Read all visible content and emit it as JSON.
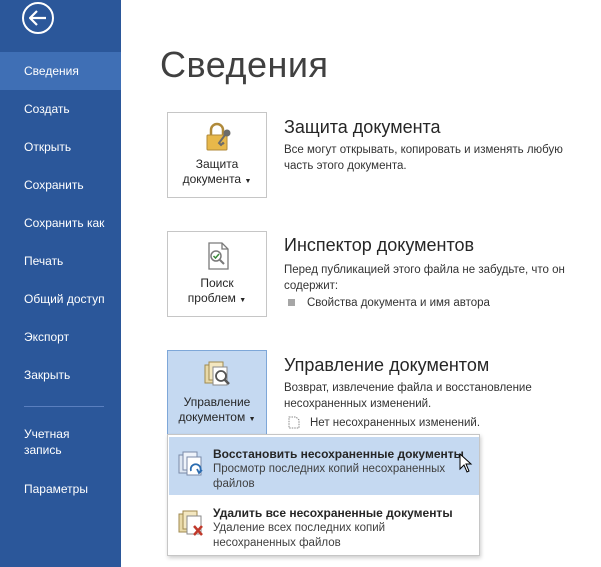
{
  "sidebar": {
    "items": [
      {
        "label": "Сведения"
      },
      {
        "label": "Создать"
      },
      {
        "label": "Открыть"
      },
      {
        "label": "Сохранить"
      },
      {
        "label": "Сохранить как"
      },
      {
        "label": "Печать"
      },
      {
        "label": "Общий доступ"
      },
      {
        "label": "Экспорт"
      },
      {
        "label": "Закрыть"
      },
      {
        "label": "Учетная запись"
      },
      {
        "label": "Параметры"
      }
    ]
  },
  "page": {
    "title": "Сведения"
  },
  "protect": {
    "tile_line1": "Защита",
    "tile_line2": "документа",
    "title": "Защита документа",
    "desc": "Все могут открывать, копировать и изменять любую часть этого документа."
  },
  "inspect": {
    "tile_line1": "Поиск",
    "tile_line2": "проблем",
    "title": "Инспектор документов",
    "desc": "Перед публикацией этого файла не забудьте, что он содержит:",
    "bullet": "Свойства документа и имя автора"
  },
  "manage": {
    "tile_line1": "Управление",
    "tile_line2": "документом",
    "title": "Управление документом",
    "desc": "Возврат, извлечение файла и восстановление несохраненных изменений.",
    "note": "Нет несохраненных изменений."
  },
  "menu": {
    "items": [
      {
        "title": "Восстановить несохраненные документы",
        "desc": "Просмотр последних копий несохраненных файлов"
      },
      {
        "title": "Удалить все несохраненные документы",
        "desc": "Удаление всех последних копий несохраненных файлов"
      }
    ]
  },
  "colors": {
    "sidebar": "#2b579a",
    "sidebar_active": "#3f6fb5",
    "hover": "#c5d9f1"
  }
}
